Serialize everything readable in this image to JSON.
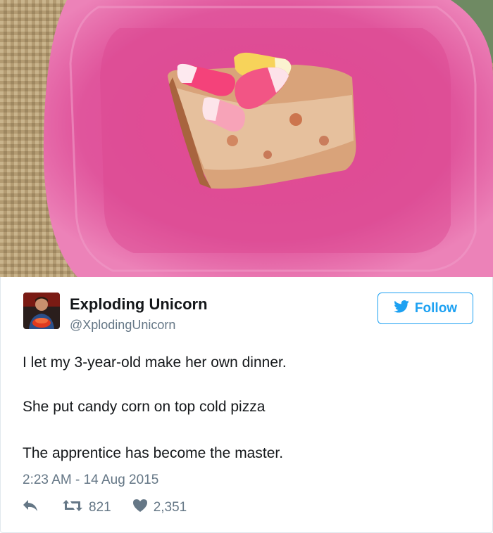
{
  "photo": {
    "alt_subject": "slice of cold pizza with candy corn on a pink plastic plate",
    "colors": {
      "placemat": "#b8a37a",
      "plate": "#e3509b",
      "pizza": "#d99a72"
    }
  },
  "author": {
    "name": "Exploding Unicorn",
    "handle": "@XplodingUnicorn"
  },
  "follow_button": {
    "label": "Follow",
    "accent": "#1da1f2"
  },
  "tweet": {
    "lines": [
      "I let my 3-year-old make her own dinner.",
      "She put candy corn on top cold pizza",
      "The apprentice has become the master."
    ],
    "timestamp": "2:23 AM - 14 Aug 2015"
  },
  "actions": {
    "reply_icon": "reply-icon",
    "retweet_icon": "retweet-icon",
    "retweet_count": "821",
    "like_icon": "heart-icon",
    "like_count": "2,351"
  }
}
